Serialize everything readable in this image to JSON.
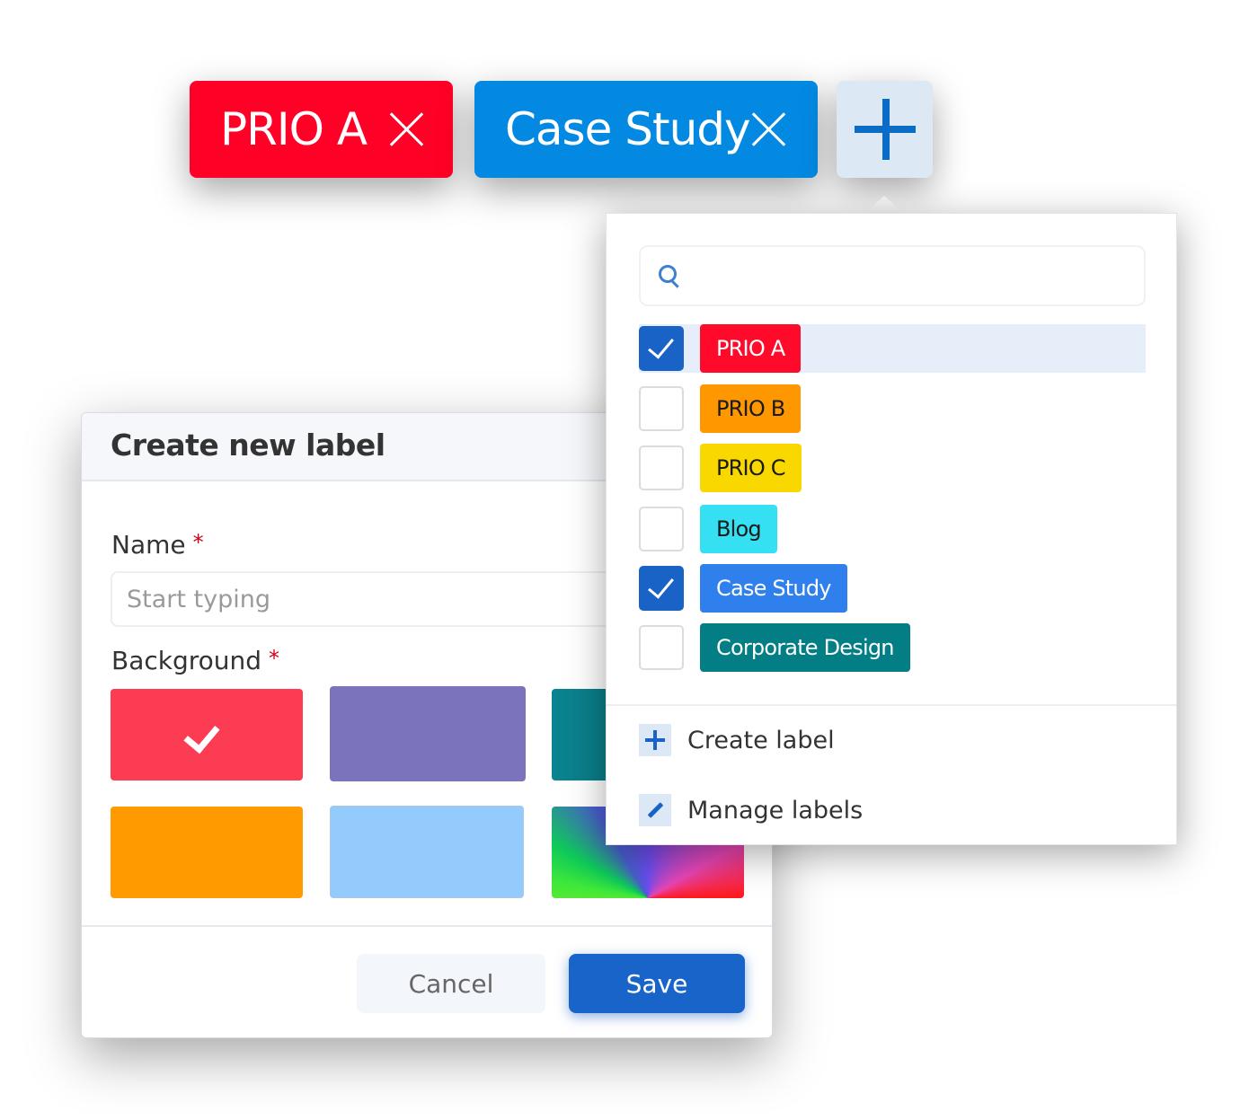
{
  "selected_chips": [
    {
      "label": "PRIO A",
      "color": "#ff0026"
    },
    {
      "label": "Case Study",
      "color": "#0389e2"
    }
  ],
  "add_button": {
    "icon": "plus-icon"
  },
  "dropdown": {
    "search": {
      "placeholder": "",
      "value": "",
      "icon": "search-icon"
    },
    "labels": [
      {
        "label": "PRIO A",
        "checked": true,
        "bg": "#ff0a2a",
        "fg": "#ffffff",
        "highlighted": true
      },
      {
        "label": "PRIO B",
        "checked": false,
        "bg": "#ff9800",
        "fg": "#1a1a1a"
      },
      {
        "label": "PRIO C",
        "checked": false,
        "bg": "#f9d800",
        "fg": "#1a1a1a"
      },
      {
        "label": "Blog",
        "checked": false,
        "bg": "#34e0f1",
        "fg": "#1a1a1a"
      },
      {
        "label": "Case Study",
        "checked": true,
        "bg": "#2f80ed",
        "fg": "#ffffff"
      },
      {
        "label": "Corporate Design",
        "checked": false,
        "bg": "#037e85",
        "fg": "#ffffff"
      }
    ],
    "actions": {
      "create_label": "Create label",
      "manage_labels": "Manage labels"
    }
  },
  "dialog": {
    "title": "Create new label",
    "name_label": "Name",
    "name_required": "*",
    "name_placeholder": "Start typing",
    "name_value": "",
    "background_label": "Background",
    "background_required": "*",
    "swatches": [
      {
        "name": "red",
        "color": "#fc3c52",
        "selected": true
      },
      {
        "name": "purple",
        "color": "#7b74bc",
        "selected": false
      },
      {
        "name": "teal",
        "color": "#0a7d8c",
        "selected": false
      },
      {
        "name": "orange",
        "color": "#ff9a00",
        "selected": false
      },
      {
        "name": "light-blue",
        "color": "#92cbfc",
        "selected": false
      },
      {
        "name": "custom-gradient",
        "color": "conic",
        "selected": false
      }
    ],
    "cancel_label": "Cancel",
    "save_label": "Save"
  }
}
